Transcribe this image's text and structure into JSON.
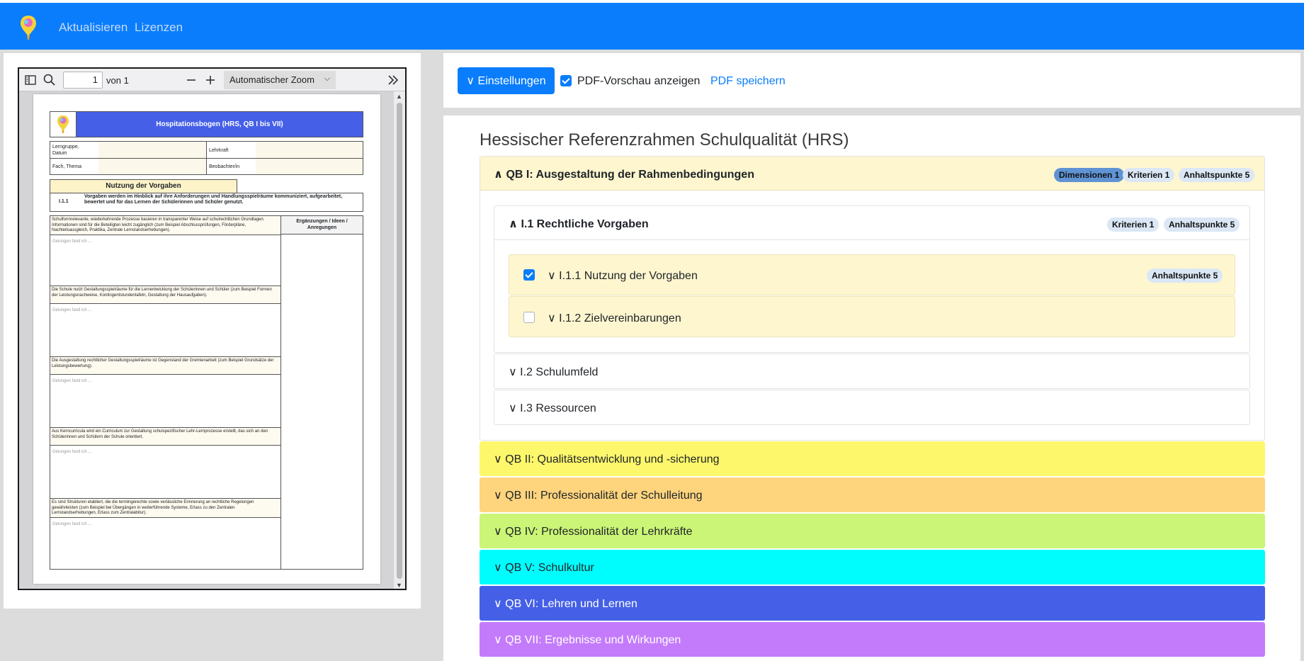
{
  "navbar": {
    "links": [
      "Aktualisieren",
      "Lizenzen"
    ]
  },
  "viewer": {
    "page_current": "1",
    "page_of": "von 1",
    "zoom": "Automatischer Zoom"
  },
  "pdf": {
    "title": "Hospitationsbogen (HRS, QB I bis VII)",
    "meta": {
      "lerngruppe": "Lerngruppe, Datum",
      "fach": "Fach, Thema",
      "lehrkraft": "Lehrkraft",
      "beobachter": "Beobachter/in"
    },
    "section_title": "Nutzung der Vorgaben",
    "criterion_num": "I.1.1",
    "criterion_text": "Vorgaben werden im Hinblick auf ihre Anforderungen und Handlungsspielräume kommuniziert, aufgearbeitet, bewertet und für das Lernen der Schülerinnen und Schüler genutzt.",
    "col_head": "Ergänzungen / Ideen / Anregungen",
    "rows": [
      "Schulformrelevante, wiederkehrende Prozesse basieren in transparenter Weise auf schulrechtlichen Grundlagen. Informationen sind für die Beteiligten leicht zugänglich (zum Beispiel Abschlussprüfungen, Förderpläne, Nachteilsausgleich, Praktika, Zentrale Lernstandserhebungen).",
      "Die Schule nutzt Gestaltungsspielräume für die Lernentwicklung der Schülerinnen und Schüler (zum Beispiel Formen der Leistungsnachweise, Kontingentstundentafeln, Gestaltung der Hausaufgaben).",
      "Die Ausgestaltung rechtlicher Gestaltungsspielräume ist Gegenstand der Gremienarbeit (zum Beispiel Grundsätze der Leistungsbewertung).",
      "Aus Kerncurricula wird ein Curriculum zur Gestaltung schulspezifischer Lehr-Lernprozesse erstellt, das sich an den Schülerinnen und Schülern der Schule orientiert.",
      "Es sind Strukturen etabliert, die die termingerechte sowie verlässliche Erinnerung an rechtliche Regelungen gewährleisten (zum Beispiel bei Übergängen in weiterführende Systeme, Erlass zu den Zentralen Lernstandserhebungen, Erlass zum Zentralabitur)."
    ],
    "placeholder": "Gelungen fand ich ..."
  },
  "controls": {
    "settings_label": "∨ Einstellungen",
    "preview_label": "PDF-Vorschau anzeigen",
    "save_label": "PDF speichern"
  },
  "main": {
    "title": "Hessischer Referenzrahmen Schulqualität (HRS)",
    "qb1": {
      "title": "∧ QB I: Ausgestaltung der Rahmenbedingungen",
      "badges": [
        "Dimensionen 1",
        "Kriterien 1",
        "Anhaltspunkte 5"
      ],
      "i1": {
        "title": "∧ I.1 Rechtliche Vorgaben",
        "badges": [
          "Kriterien 1",
          "Anhaltspunkte 5"
        ],
        "items": [
          {
            "label": "∨ I.1.1 Nutzung der Vorgaben",
            "checked": true,
            "badge": "Anhaltspunkte 5"
          },
          {
            "label": "∨ I.1.2 Zielvereinbarungen",
            "checked": false
          }
        ]
      },
      "subs": [
        "∨ I.2 Schulumfeld",
        "∨ I.3 Ressourcen"
      ]
    },
    "qbs": [
      {
        "title": "∨ QB II: Qualitätsentwicklung und -sicherung",
        "color": "#fdf76b",
        "text": "#212529"
      },
      {
        "title": "∨ QB III: Professionalität der Schulleitung",
        "color": "#fed47d",
        "text": "#212529"
      },
      {
        "title": "∨ QB IV: Professionalität der Lehrkräfte",
        "color": "#cbf576",
        "text": "#212529"
      },
      {
        "title": "∨ QB V: Schulkultur",
        "color": "#00fdfd",
        "text": "#212529"
      },
      {
        "title": "∨ QB VI: Lehren und Lernen",
        "color": "#4560e6",
        "text": "#ffffff"
      },
      {
        "title": "∨ QB VII: Ergebnisse und Wirkungen",
        "color": "#c47bfb",
        "text": "#ffffff"
      }
    ]
  }
}
